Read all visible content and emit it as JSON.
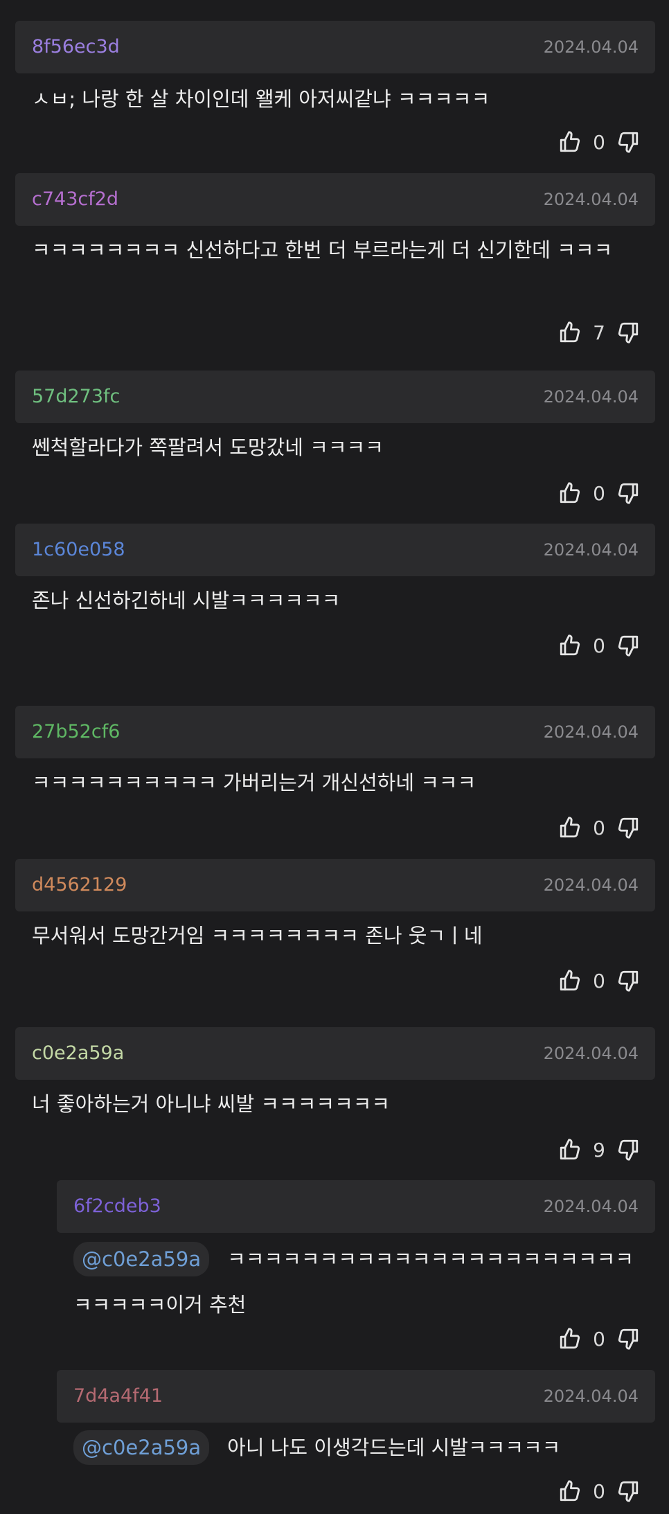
{
  "comments": [
    {
      "user": "8f56ec3d",
      "user_color": "#9b7fe0",
      "date": "2024.04.04",
      "text": "ㅅㅂ; 나랑 한 살 차이인데 왤케 아저씨같냐 ㅋㅋㅋㅋㅋ",
      "likes": "0",
      "like_icon": "thumbs-up-icon",
      "dislike_icon": "thumbs-down-icon"
    },
    {
      "user": "c743cf2d",
      "user_color": "#b56fcf",
      "date": "2024.04.04",
      "text": "ㅋㅋㅋㅋㅋㅋㅋㅋ 신선하다고 한번 더 부르라는게 더 신기한데 ㅋㅋㅋ",
      "likes": "7"
    },
    {
      "user": "57d273fc",
      "user_color": "#6fbf7f",
      "date": "2024.04.04",
      "text": "쎈척할라다가 쪽팔려서 도망갔네 ㅋㅋㅋㅋ",
      "likes": "0"
    },
    {
      "user": "1c60e058",
      "user_color": "#5b86d8",
      "date": "2024.04.04",
      "text": "존나 신선하긴하네 시발ㅋㅋㅋㅋㅋㅋ",
      "likes": "0"
    },
    {
      "user": "27b52cf6",
      "user_color": "#5fb864",
      "date": "2024.04.04",
      "text": "ㅋㅋㅋㅋㅋㅋㅋㅋㅋㅋ 가버리는거 개신선하네 ㅋㅋㅋ",
      "likes": "0"
    },
    {
      "user": "d4562129",
      "user_color": "#d08a5c",
      "date": "2024.04.04",
      "text": "무서워서 도망간거임 ㅋㅋㅋㅋㅋㅋㅋㅋ 존나 웃ㄱㅣ네",
      "likes": "0"
    },
    {
      "user": "c0e2a59a",
      "user_color": "#c4d9a6",
      "date": "2024.04.04",
      "text": "너 좋아하는거 아니냐 씨발 ㅋㅋㅋㅋㅋㅋㅋ",
      "likes": "9"
    }
  ],
  "replies": [
    {
      "user": "6f2cdeb3",
      "user_color": "#7d62d8",
      "date": "2024.04.04",
      "mention": "@c0e2a59a",
      "text": "ㅋㅋㅋㅋㅋㅋㅋㅋㅋㅋㅋㅋㅋㅋㅋㅋㅋㅋㅋㅋㅋㅋㅋㅋㅋㅋㅋ이거 추천",
      "likes": "0"
    },
    {
      "user": "7d4a4f41",
      "user_color": "#b56a72",
      "date": "2024.04.04",
      "mention": "@c0e2a59a",
      "text": "아니 나도 이생각드는데 시발ㅋㅋㅋㅋㅋ",
      "likes": "0"
    }
  ]
}
